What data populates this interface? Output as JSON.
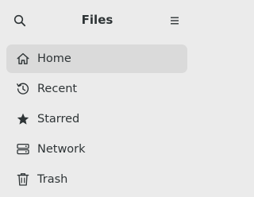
{
  "window": {
    "title": "Files"
  },
  "header": {
    "search_icon": "search-icon",
    "menu_icon": "hamburger-menu-icon"
  },
  "sidebar": {
    "items": [
      {
        "label": "Home",
        "icon": "home-icon",
        "active": true
      },
      {
        "label": "Recent",
        "icon": "recent-clock-icon",
        "active": false
      },
      {
        "label": "Starred",
        "icon": "star-icon",
        "active": false
      },
      {
        "label": "Network",
        "icon": "network-icon",
        "active": false
      },
      {
        "label": "Trash",
        "icon": "trash-icon",
        "active": false
      }
    ]
  },
  "colors": {
    "background": "#ebebeb",
    "active_row": "#dadada",
    "text": "#2e3436"
  }
}
